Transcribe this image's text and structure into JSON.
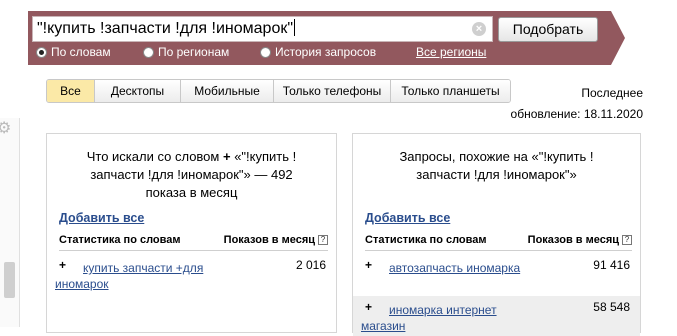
{
  "search": {
    "query": "\"!купить !запчасти !для !иномарок\"",
    "submit_label": "Подобрать"
  },
  "scope_options": [
    {
      "label": "По словам",
      "selected": true
    },
    {
      "label": "По регионам",
      "selected": false
    },
    {
      "label": "История запросов",
      "selected": false
    }
  ],
  "regions_link": "Все регионы",
  "tabs": [
    {
      "label": "Все",
      "active": true
    },
    {
      "label": "Десктопы",
      "active": false
    },
    {
      "label": "Мобильные",
      "active": false
    },
    {
      "label": "Только телефоны",
      "active": false
    },
    {
      "label": "Только планшеты",
      "active": false
    }
  ],
  "updated": {
    "line1": "Последнее",
    "line2": "обновление: 18.11.2020"
  },
  "left_panel": {
    "title_line1": "Что искали со словом",
    "title_line1_tail": "«\"!купить !",
    "title_line2": "запчасти !для !иномарок\"» — 492",
    "title_line3": "показа в месяц",
    "add_all": "Добавить все",
    "col_words": "Статистика по словам",
    "col_shows": "Показов в месяц",
    "rows": [
      {
        "keyword": "купить запчасти +для иномарок",
        "count": "2 016"
      }
    ]
  },
  "right_panel": {
    "title_line1": "Запросы, похожие на «\"!купить !",
    "title_line2": "запчасти !для !иномарок\"»",
    "add_all": "Добавить все",
    "col_words": "Статистика по словам",
    "col_shows": "Показов в месяц",
    "rows": [
      {
        "keyword": "автозапчасть иномарка",
        "count": "91 416"
      },
      {
        "keyword": "иномарка интернет магазин",
        "count": "58 548"
      }
    ]
  },
  "colors": {
    "band": "#92585e",
    "link": "#2a4d8d",
    "active_tab": "#fbe9a7"
  },
  "icons": {
    "clear": "circle-x",
    "add": "plus",
    "help": "question-square",
    "settings": "gear"
  }
}
